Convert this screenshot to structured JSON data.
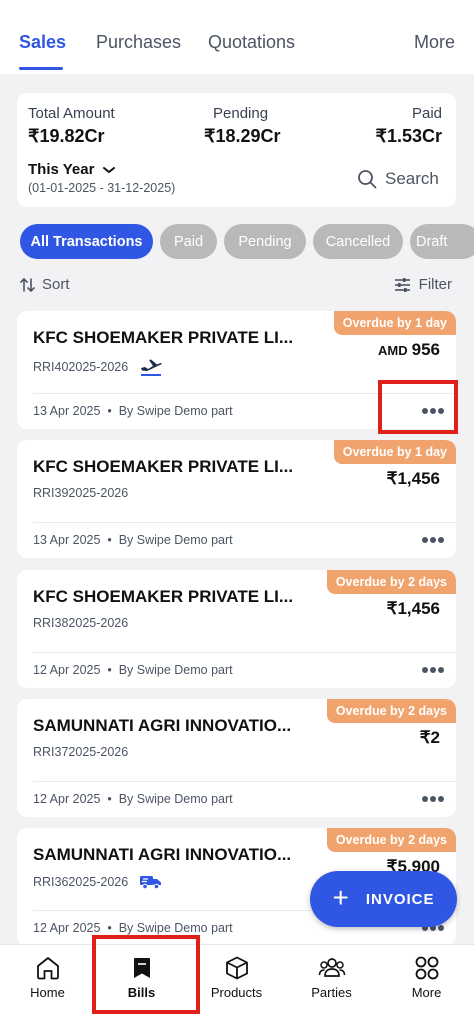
{
  "top_tabs": {
    "sales": "Sales",
    "purchases": "Purchases",
    "quotations": "Quotations",
    "more": "More"
  },
  "summary": {
    "total_label": "Total Amount",
    "total_value": "₹19.82Cr",
    "pending_label": "Pending",
    "pending_value": "₹18.29Cr",
    "paid_label": "Paid",
    "paid_value": "₹1.53Cr",
    "period": "This Year",
    "date_range": "(01-01-2025 - 31-12-2025)",
    "search_label": "Search"
  },
  "filters": [
    "All Transactions",
    "Paid",
    "Pending",
    "Cancelled",
    "Draft"
  ],
  "sort_label": "Sort",
  "filter_label": "Filter",
  "invoices": [
    {
      "customer": "KFC SHOEMAKER PRIVATE LI...",
      "number": "RRI402025-2026",
      "currency": "AMD",
      "amount": "956",
      "status": "Overdue by 1 day",
      "date": "13 Apr 2025",
      "by": "By Swipe Demo part",
      "icon": "airplane-icon"
    },
    {
      "customer": "KFC SHOEMAKER PRIVATE LI...",
      "number": "RRI392025-2026",
      "currency": "",
      "amount": "₹1,456",
      "status": "Overdue by 1 day",
      "date": "13 Apr 2025",
      "by": "By Swipe Demo part",
      "icon": ""
    },
    {
      "customer": "KFC SHOEMAKER PRIVATE LI...",
      "number": "RRI382025-2026",
      "currency": "",
      "amount": "₹1,456",
      "status": "Overdue by 2 days",
      "date": "12 Apr 2025",
      "by": "By Swipe Demo part",
      "icon": ""
    },
    {
      "customer": "SAMUNNATI AGRI INNOVATIO...",
      "number": "RRI372025-2026",
      "currency": "",
      "amount": "₹2",
      "status": "Overdue by 2 days",
      "date": "12 Apr 2025",
      "by": "By Swipe Demo part",
      "icon": ""
    },
    {
      "customer": "SAMUNNATI AGRI INNOVATIO...",
      "number": "RRI362025-2026",
      "currency": "",
      "amount": "₹5,900",
      "status": "Overdue by 2 days",
      "date": "12 Apr 2025",
      "by": "By Swipe Demo part",
      "icon": "delivery-truck-icon"
    }
  ],
  "fab_label": "INVOICE",
  "bottom_nav": {
    "home": "Home",
    "bills": "Bills",
    "products": "Products",
    "parties": "Parties",
    "more": "More"
  },
  "colors": {
    "accent": "#2f57e3",
    "overdue_badge": "#f0a36c",
    "chip_inactive": "#b9b9b9",
    "highlight": "#e0201b"
  }
}
